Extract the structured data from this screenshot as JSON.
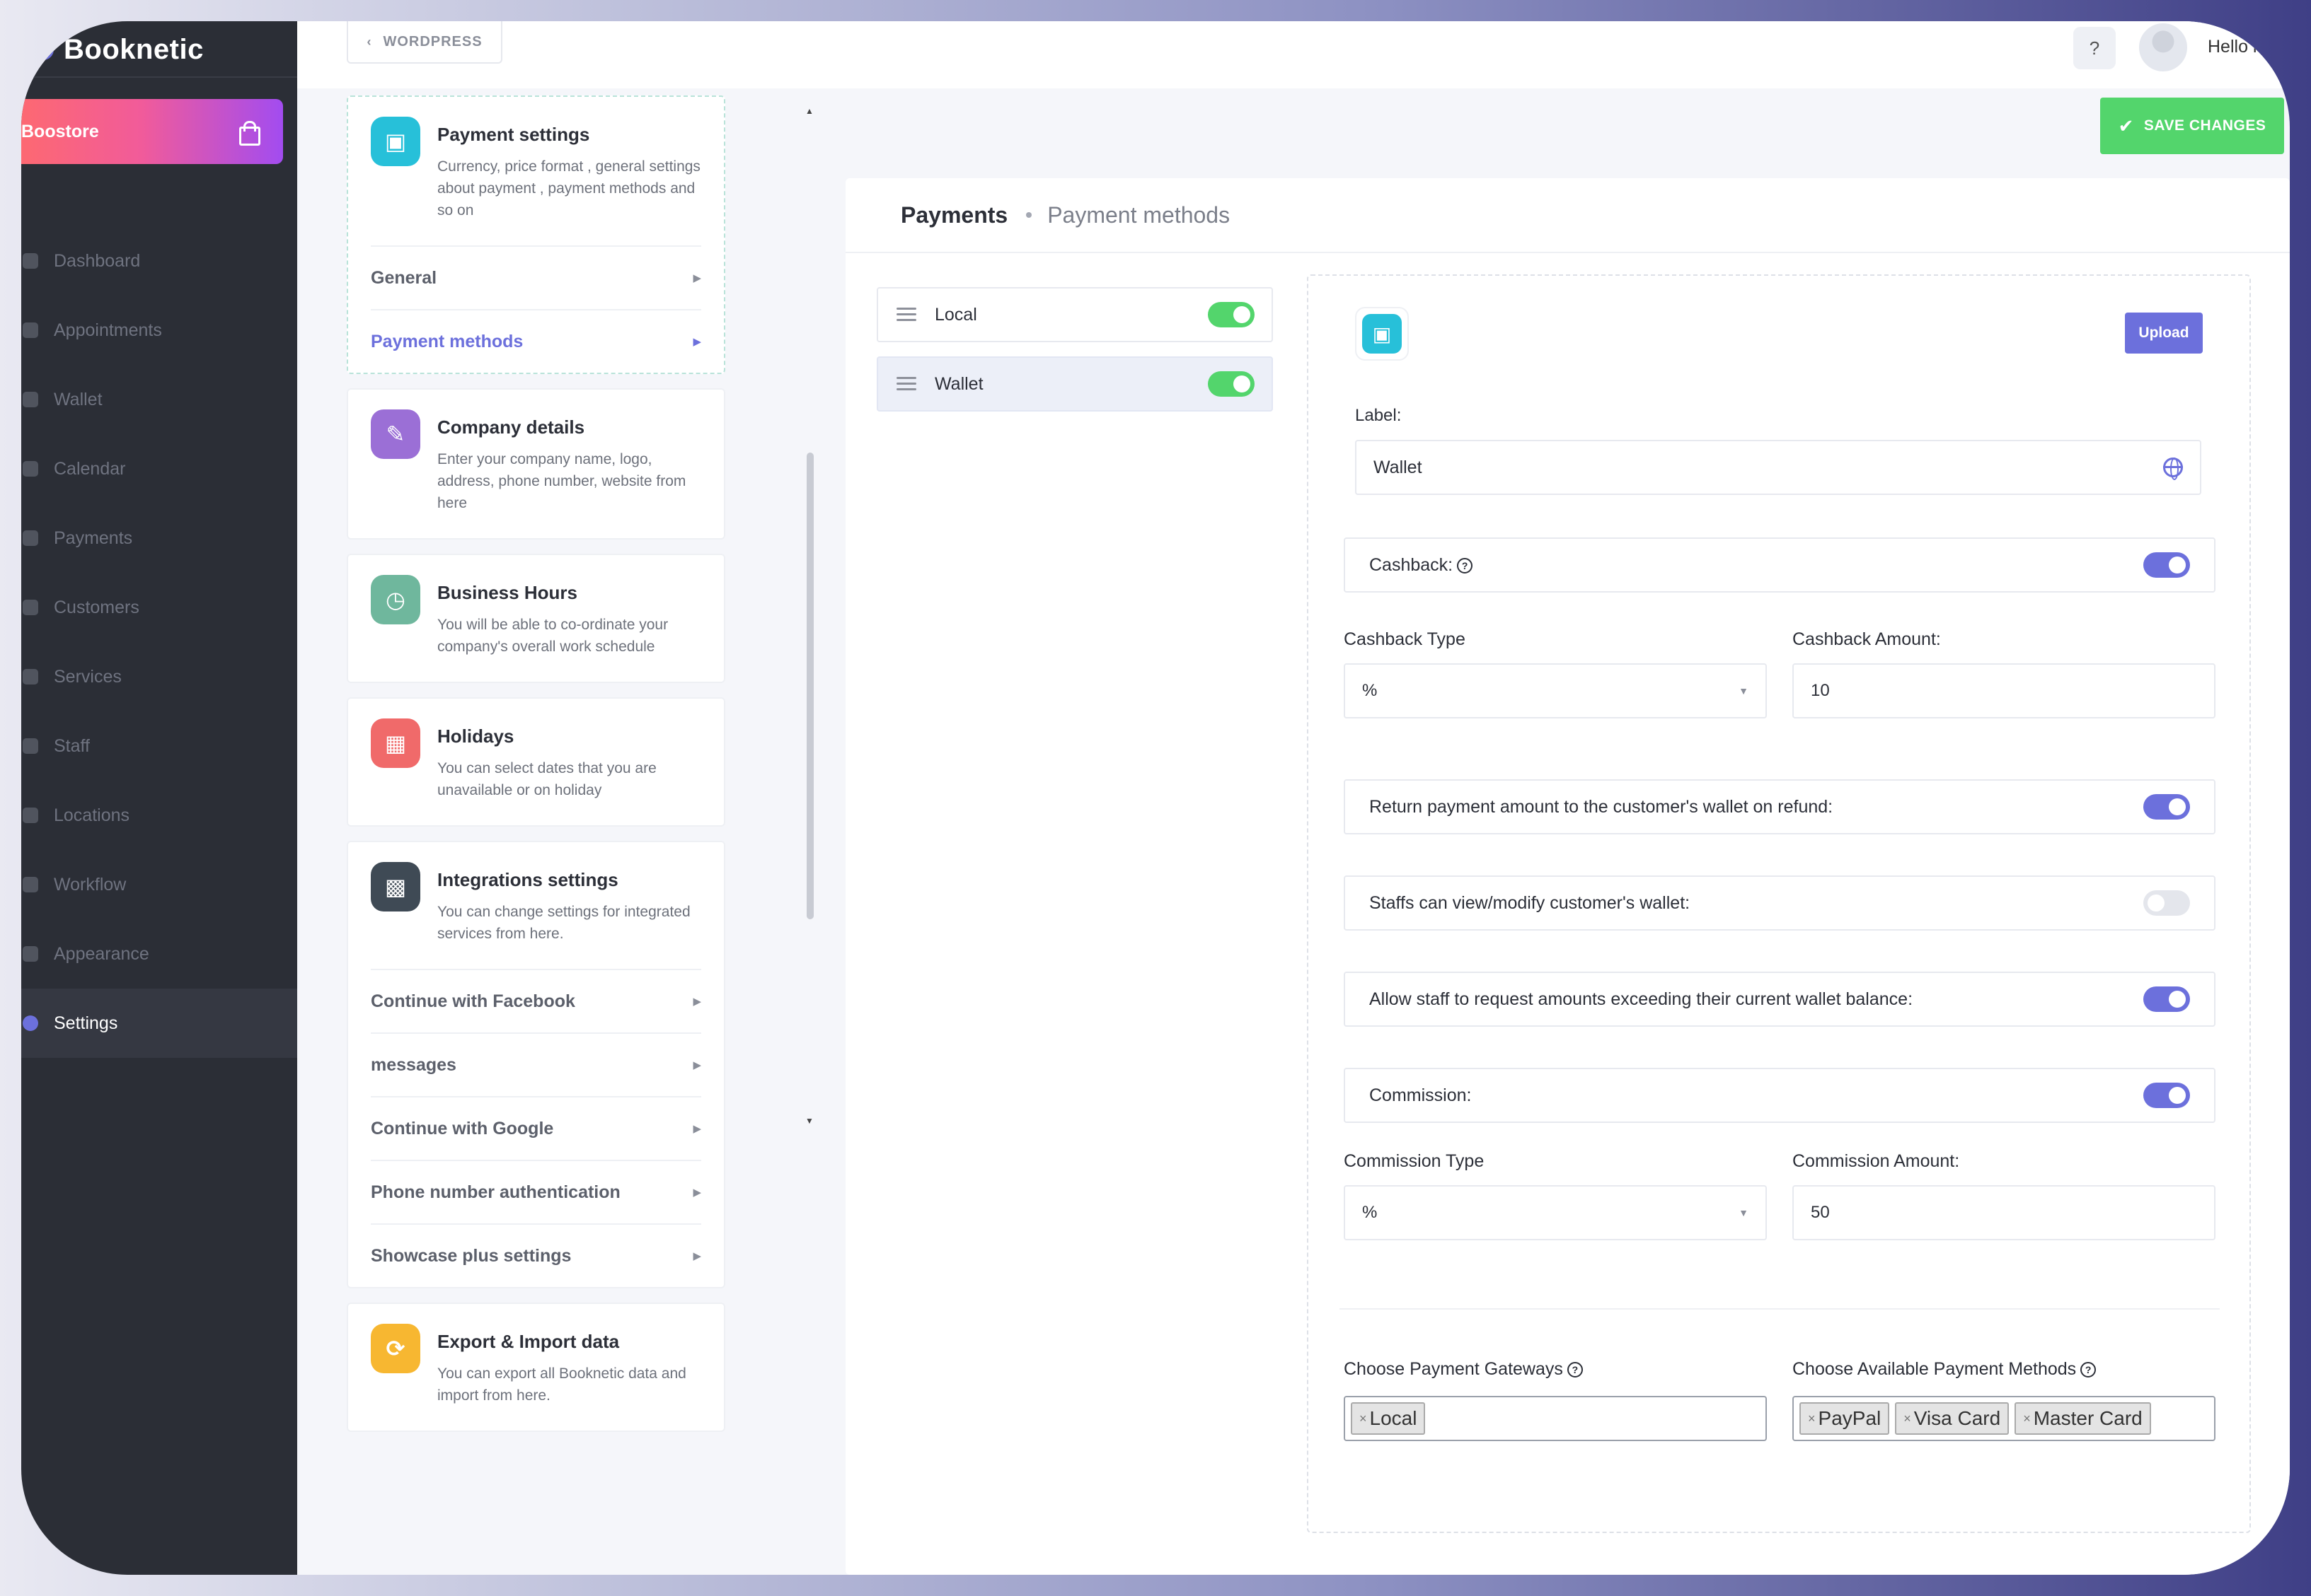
{
  "brand": {
    "name": "Booknetic"
  },
  "sidebar": {
    "boostore_label": "Boostore",
    "items": [
      {
        "label": "Dashboard",
        "icon": "dashboard-icon"
      },
      {
        "label": "Appointments",
        "icon": "clock-icon"
      },
      {
        "label": "Wallet",
        "icon": "wallet-icon"
      },
      {
        "label": "Calendar",
        "icon": "calendar-icon"
      },
      {
        "label": "Payments",
        "icon": "payments-icon"
      },
      {
        "label": "Customers",
        "icon": "customers-icon"
      },
      {
        "label": "Services",
        "icon": "services-icon"
      },
      {
        "label": "Staff",
        "icon": "staff-icon"
      },
      {
        "label": "Locations",
        "icon": "location-icon"
      },
      {
        "label": "Workflow",
        "icon": "workflow-icon"
      },
      {
        "label": "Appearance",
        "icon": "brush-icon"
      },
      {
        "label": "Settings",
        "icon": "gear-icon",
        "active": true
      }
    ]
  },
  "topbar": {
    "back_label": "WORDPRESS",
    "greeting": "Hello rcm"
  },
  "settings_cards": {
    "payment": {
      "title": "Payment settings",
      "desc": "Currency, price format , general settings about payment , payment methods and so on",
      "sub": [
        "General",
        "Payment methods"
      ],
      "color": "#27c0d9"
    },
    "company": {
      "title": "Company details",
      "desc": "Enter your company name, logo, address, phone number, website from here",
      "color": "#9b6fd6"
    },
    "hours": {
      "title": "Business Hours",
      "desc": "You will be able to co-ordinate your company's overall work schedule",
      "color": "#6fb79d"
    },
    "holidays": {
      "title": "Holidays",
      "desc": "You can select dates that you are unavailable or on holiday",
      "color": "#f06a6a"
    },
    "integrations": {
      "title": "Integrations settings",
      "desc": "You can change settings for integrated services from here.",
      "sub": [
        "Continue with Facebook",
        "messages",
        "Continue with Google",
        "Phone number authentication",
        "Showcase plus settings"
      ],
      "color": "#3f4a55"
    },
    "export": {
      "title": "Export & Import data",
      "desc": "You can export all Booknetic data and import from here.",
      "color": "#f7b731"
    }
  },
  "save_label": "SAVE CHANGES",
  "main": {
    "breadcrumb": [
      "Payments",
      "Payment methods"
    ],
    "methods": [
      {
        "label": "Local",
        "enabled": true
      },
      {
        "label": "Wallet",
        "enabled": true,
        "selected": true
      }
    ],
    "detail": {
      "upload_label": "Upload",
      "label_caption": "Label:",
      "label_value": "Wallet",
      "cashback_label": "Cashback:",
      "cashback_on": true,
      "cashback_type_label": "Cashback Type",
      "cashback_type_value": "%",
      "cashback_amount_label": "Cashback Amount:",
      "cashback_amount_value": "10",
      "refund_label": "Return payment amount to the customer's wallet on refund:",
      "refund_on": true,
      "staff_view_label": "Staffs can view/modify customer's wallet:",
      "staff_view_on": false,
      "exceed_label": "Allow staff to request amounts exceeding their current wallet balance:",
      "exceed_on": true,
      "commission_label": "Commission:",
      "commission_on": true,
      "commission_type_label": "Commission Type",
      "commission_type_value": "%",
      "commission_amount_label": "Commission Amount:",
      "commission_amount_value": "50",
      "gateways_label": "Choose Payment Gateways",
      "gateways": [
        "Local"
      ],
      "methods_label": "Choose Available Payment Methods",
      "available_methods": [
        "PayPal",
        "Visa Card",
        "Master Card"
      ]
    }
  },
  "colors": {
    "accent": "#6c70dc",
    "success": "#53d56c",
    "sidebar": "#2b2e36"
  }
}
